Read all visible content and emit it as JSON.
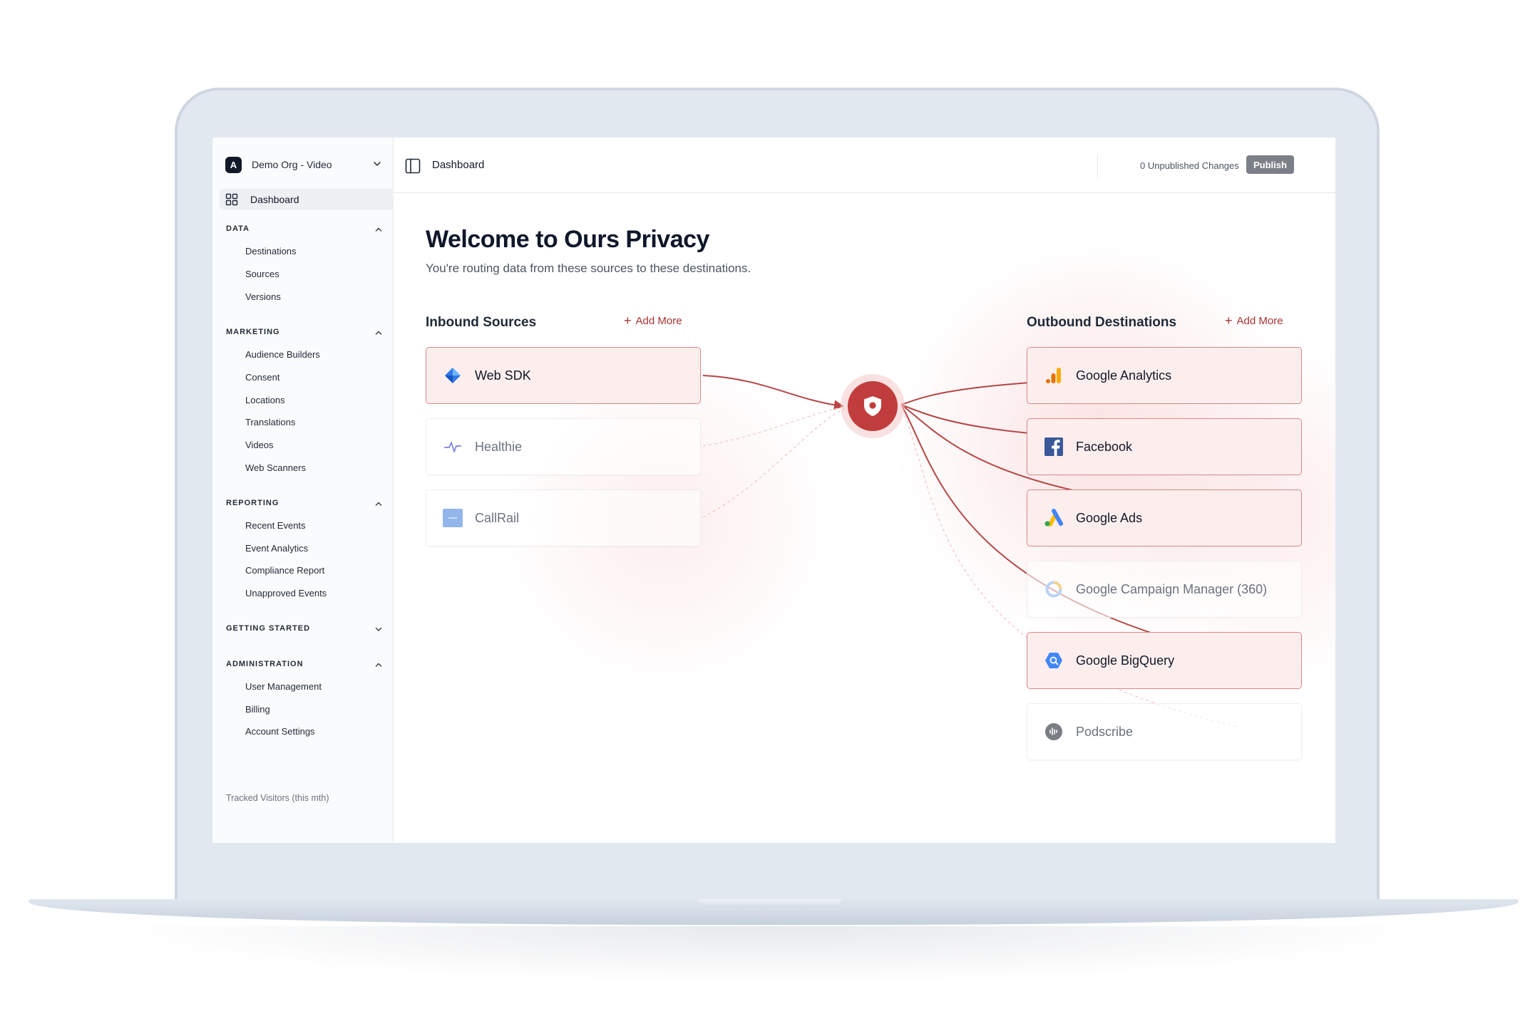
{
  "org": {
    "logo_letter": "A",
    "name": "Demo Org - Video"
  },
  "sidebar": {
    "dashboard_label": "Dashboard",
    "sections": [
      {
        "title": "DATA",
        "items": [
          "Destinations",
          "Sources",
          "Versions"
        ]
      },
      {
        "title": "MARKETING",
        "items": [
          "Audience Builders",
          "Consent",
          "Locations",
          "Translations",
          "Videos",
          "Web Scanners"
        ]
      },
      {
        "title": "REPORTING",
        "items": [
          "Recent Events",
          "Event Analytics",
          "Compliance Report",
          "Unapproved Events"
        ]
      },
      {
        "title": "GETTING STARTED",
        "items": []
      },
      {
        "title": "ADMINISTRATION",
        "items": [
          "User Management",
          "Billing",
          "Account Settings"
        ]
      }
    ],
    "tracked_label": "Tracked Visitors (this mth)"
  },
  "topbar": {
    "title": "Dashboard",
    "unpublished_text": "0 Unpublished Changes",
    "publish_label": "Publish"
  },
  "main": {
    "welcome_title": "Welcome to Ours Privacy",
    "subtitle": "You're routing data from these sources to these destinations.",
    "inbound": {
      "title": "Inbound Sources",
      "add_more": "Add More",
      "items": [
        {
          "label": "Web SDK",
          "active": true,
          "icon": "web-sdk-icon"
        },
        {
          "label": "Healthie",
          "active": false,
          "icon": "healthie-icon"
        },
        {
          "label": "CallRail",
          "active": false,
          "icon": "callrail-icon"
        }
      ]
    },
    "outbound": {
      "title": "Outbound Destinations",
      "add_more": "Add More",
      "items": [
        {
          "label": "Google Analytics",
          "active": true,
          "icon": "google-analytics-icon"
        },
        {
          "label": "Facebook",
          "active": true,
          "icon": "facebook-icon"
        },
        {
          "label": "Google Ads",
          "active": true,
          "icon": "google-ads-icon"
        },
        {
          "label": "Google Campaign Manager (360)",
          "active": false,
          "icon": "campaign-manager-icon"
        },
        {
          "label": "Google BigQuery",
          "active": true,
          "icon": "bigquery-icon"
        },
        {
          "label": "Podscribe",
          "active": false,
          "icon": "podscribe-icon"
        }
      ]
    },
    "hub_icon": "shield-icon"
  },
  "colors": {
    "accent": "#c13c3c",
    "link": "#a83232",
    "active_card_bg": "#fdeeee",
    "active_card_border": "#d98787",
    "flow_line": "#b54545"
  }
}
